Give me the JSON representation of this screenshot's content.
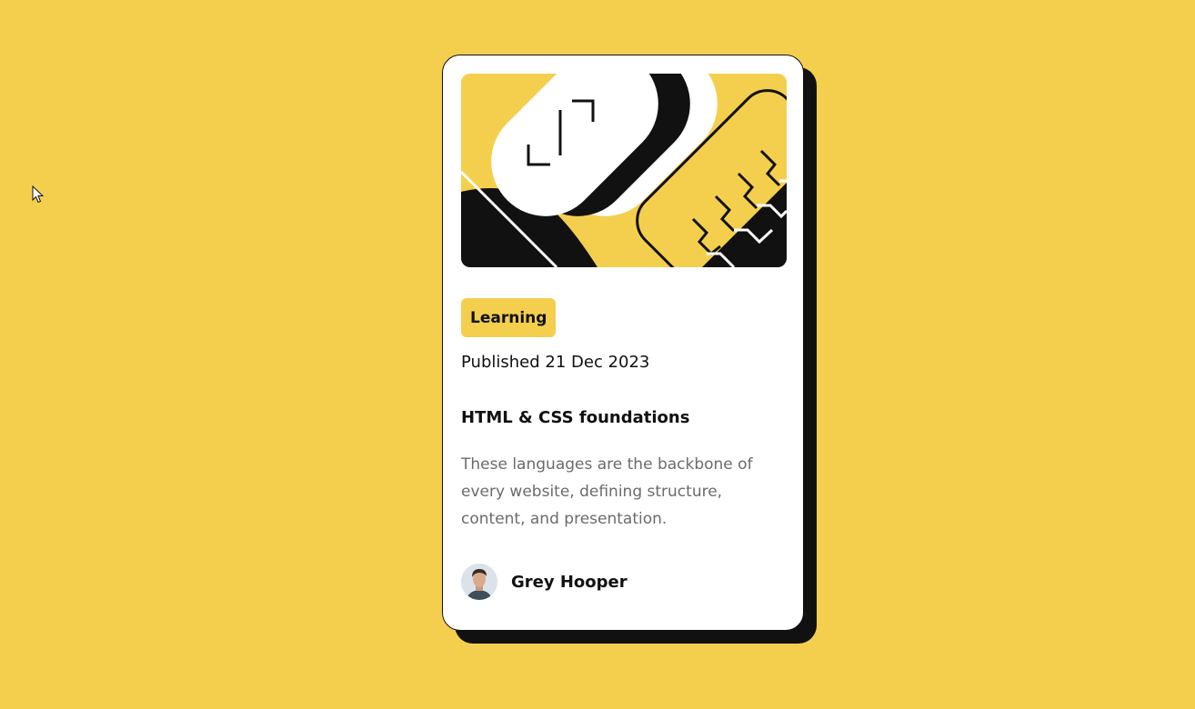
{
  "colors": {
    "background": "#F4CF4E",
    "card": "#FFFFFF",
    "ink": "#111111",
    "muted_text": "#6B6B6B",
    "accent": "#F4CF4E"
  },
  "cursor": {
    "icon": "mouse-pointer-icon"
  },
  "card": {
    "illustration_icon": "abstract-illustration",
    "tag": "Learning",
    "published": "Published 21 Dec 2023",
    "title": "HTML & CSS foundations",
    "description": "These languages are the backbone of every website, defining structure, content, and presentation.",
    "author": {
      "name": "Grey Hooper",
      "avatar_icon": "avatar-photo"
    }
  }
}
